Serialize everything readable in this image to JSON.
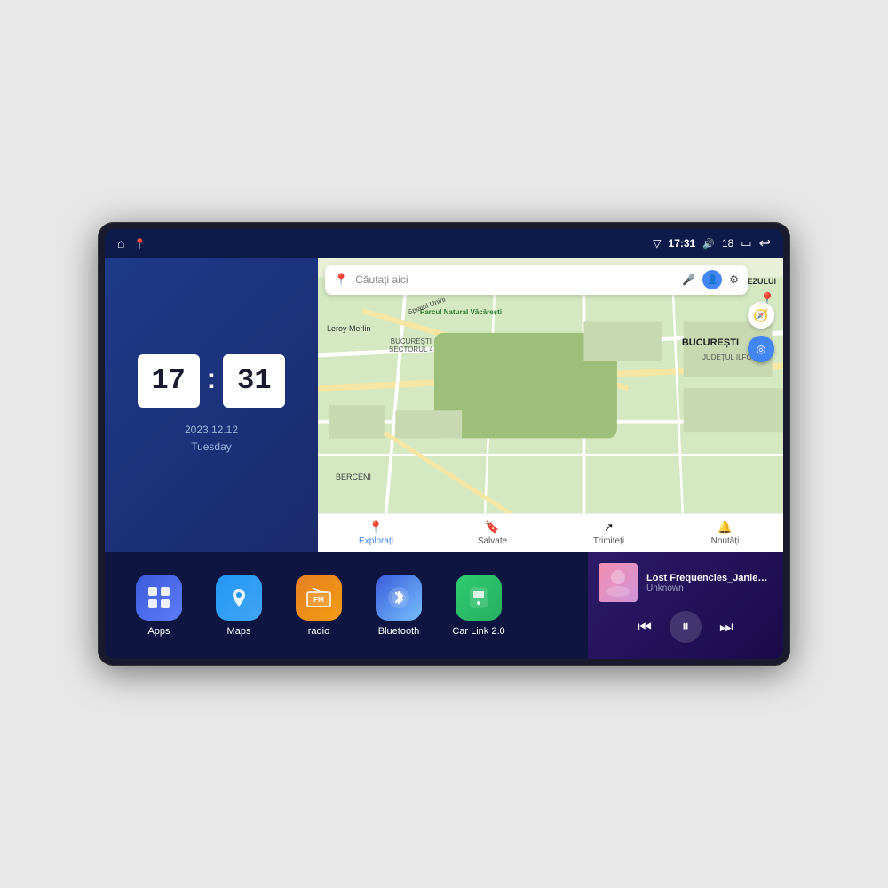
{
  "device": {
    "status_bar": {
      "signal_icon": "▽",
      "time": "17:31",
      "volume_icon": "🔊",
      "volume_level": "18",
      "battery_icon": "🔋",
      "back_icon": "↩",
      "home_icon": "⌂",
      "maps_icon": "📍"
    },
    "clock_widget": {
      "hour": "17",
      "minute": "31",
      "date": "2023.12.12",
      "day": "Tuesday"
    },
    "map": {
      "search_placeholder": "Căutați aici",
      "labels": {
        "trapezului": "TRAPEZULUI",
        "bucuresti": "BUCUREȘTI",
        "judet": "JUDEȚUL ILFOV",
        "berceni": "BERCENI",
        "splai": "Splaiul Unirii",
        "sector": "BUCUREȘTI\nSECTORUL 4",
        "parcul": "Parcul Natural Văcărești",
        "leroy": "Leroy Merlin"
      },
      "nav_tabs": [
        {
          "icon": "📍",
          "label": "Explorați",
          "active": true
        },
        {
          "icon": "🔖",
          "label": "Salvate",
          "active": false
        },
        {
          "icon": "↗",
          "label": "Trimiteți",
          "active": false
        },
        {
          "icon": "🔔",
          "label": "Noutăți",
          "active": false
        }
      ]
    },
    "apps": [
      {
        "id": "apps",
        "label": "Apps",
        "icon": "⊞",
        "color_class": "app-apps"
      },
      {
        "id": "maps",
        "label": "Maps",
        "icon": "🗺",
        "color_class": "app-maps"
      },
      {
        "id": "radio",
        "label": "radio",
        "icon": "📻",
        "color_class": "app-radio"
      },
      {
        "id": "bluetooth",
        "label": "Bluetooth",
        "icon": "🔵",
        "color_class": "app-bluetooth"
      },
      {
        "id": "carlink",
        "label": "Car Link 2.0",
        "icon": "📱",
        "color_class": "app-carlink"
      }
    ],
    "music": {
      "title": "Lost Frequencies_Janieck Devy-...",
      "artist": "Unknown",
      "prev_icon": "⏮",
      "play_icon": "⏸",
      "next_icon": "⏭"
    }
  }
}
